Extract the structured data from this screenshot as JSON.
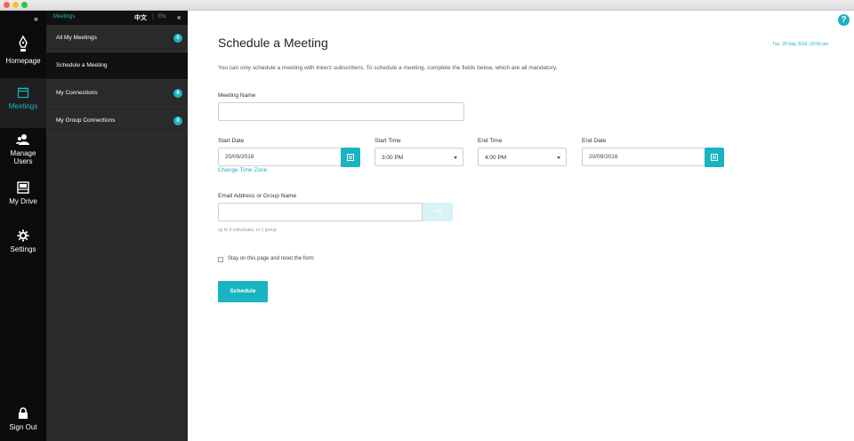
{
  "rail": {
    "items": [
      {
        "label": "Homepage",
        "icon": "pen-nib-icon"
      },
      {
        "label": "Meetings",
        "icon": "calendar-icon"
      },
      {
        "label": "Manage Users",
        "icon": "users-icon"
      },
      {
        "label": "My Drive",
        "icon": "drive-icon"
      },
      {
        "label": "Settings",
        "icon": "gear-icon"
      }
    ],
    "signout": {
      "label": "Sign Out",
      "icon": "lock-icon"
    }
  },
  "subnav": {
    "title": "Meetings",
    "lang_zh": "中文",
    "lang_sep": "|",
    "lang_en": "EN",
    "items": [
      {
        "label": "All My Meetings",
        "count": "0"
      },
      {
        "label": "Schedule a Meeting"
      },
      {
        "label": "My Connections",
        "count": "6"
      },
      {
        "label": "My Group Connections",
        "count": "0"
      }
    ]
  },
  "header": {
    "title": "Schedule a Meeting",
    "datetime": "Tue, 20 Sep 2016, 03:05 pm",
    "intro": "You can only schedule a meeting with Inkerz subscribers. To schedule a meeting, complete the fields below, which are all mandatory."
  },
  "form": {
    "meeting_name_label": "Meeting Name",
    "meeting_name_value": "",
    "start_date_label": "Start Date",
    "start_date_value": "20/09/2016",
    "start_time_label": "Start Time",
    "start_time_value": "3:00 PM",
    "end_time_label": "End Time",
    "end_time_value": "4:00 PM",
    "end_date_label": "End Date",
    "end_date_value": "20/09/2016",
    "change_tz_label": "Change Time Zone",
    "email_label": "Email Address or Group Name",
    "email_value": "",
    "add_label": "Add",
    "email_hint": "up to 9 individuals, or 1 group",
    "stay_label": "Stay on this page and reset the form",
    "stay_checked": false,
    "schedule_label": "Schedule"
  },
  "help": {
    "label": "?",
    "icon": "help-icon"
  },
  "colors": {
    "accent": "#19b4c0",
    "rail_bg": "#0b0b0b",
    "subnav_bg": "#2a2a2a"
  }
}
